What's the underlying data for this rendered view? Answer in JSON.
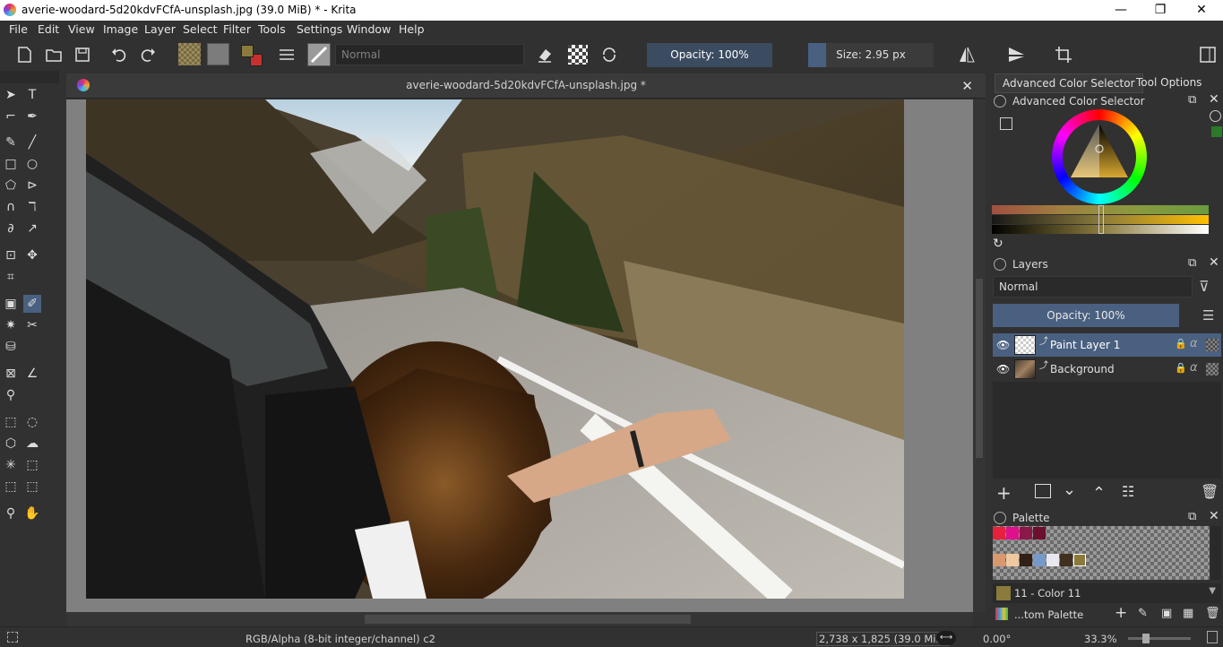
{
  "window": {
    "title": "averie-woodard-5d20kdvFCfA-unsplash.jpg (39.0 MiB)  * - Krita",
    "minimize": "—",
    "restore": "❐",
    "close": "✕"
  },
  "menu": [
    "File",
    "Edit",
    "View",
    "Image",
    "Layer",
    "Select",
    "Filter",
    "Tools",
    "Settings",
    "Window",
    "Help"
  ],
  "toolbar": {
    "blend_mode": "Normal",
    "opacity_label": "Opacity: 100%",
    "size_label": "Size: 2.95 px"
  },
  "document": {
    "tab_title": "averie-woodard-5d20kdvFCfA-unsplash.jpg *",
    "close": "✕"
  },
  "docker": {
    "tabs": [
      "Advanced Color Selector",
      "Tool Options"
    ],
    "color_selector_title": "Advanced Color Selector",
    "layers_title": "Layers",
    "layer_blend_mode": "Normal",
    "layer_opacity": "Opacity:  100%",
    "layers": [
      {
        "name": "Paint Layer 1",
        "selected": true
      },
      {
        "name": "Background",
        "selected": false
      }
    ],
    "palette_title": "Palette",
    "current_color": "11 - Color 11",
    "palette_name": "...tom Palette"
  },
  "palette_colors": [
    "#e8203c",
    "#e0108c",
    "#8c1848",
    "#6c1030",
    "#d89870",
    "#f0c8a0",
    "#302018",
    "#7898c8",
    "#e8e8f0",
    "#403020",
    "#8a7a3c"
  ],
  "status": {
    "color_model": "RGB/Alpha (8-bit integer/channel)  c2",
    "image_size": "2,738 x 1,825 (39.0 MiB)",
    "rotation": "0.00°",
    "zoom": "33.3%"
  }
}
